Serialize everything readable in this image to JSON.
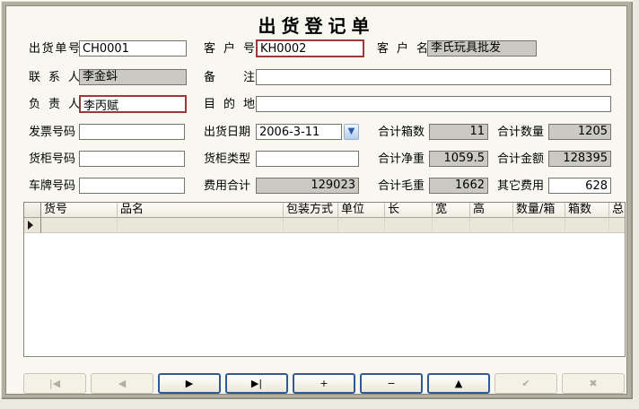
{
  "window": {
    "title": "出货登记单"
  },
  "fields": {
    "order_no": {
      "label": "出货单号",
      "value": "CH0001"
    },
    "customer_no": {
      "label": "客 户 号",
      "value": "KH0002"
    },
    "customer_name": {
      "label": "客 户 名",
      "value": "李氏玩具批发"
    },
    "contact": {
      "label": "联 系 人",
      "value": "李金蚪"
    },
    "remark": {
      "label": "备 注",
      "value": ""
    },
    "manager": {
      "label": "负 责 人",
      "value": "李丙赋"
    },
    "destination": {
      "label": "目 的 地",
      "value": ""
    },
    "invoice_no": {
      "label": "发票号码",
      "value": ""
    },
    "ship_date": {
      "label": "出货日期",
      "value": "2006-3-11"
    },
    "total_boxes": {
      "label": "合计箱数",
      "value": "11"
    },
    "total_qty": {
      "label": "合计数量",
      "value": "1205"
    },
    "container_no": {
      "label": "货柜号码",
      "value": ""
    },
    "container_type": {
      "label": "货柜类型",
      "value": ""
    },
    "total_net": {
      "label": "合计净重",
      "value": "1059.5"
    },
    "total_amount": {
      "label": "合计金额",
      "value": "128395"
    },
    "plate_no": {
      "label": "车牌号码",
      "value": ""
    },
    "expense_total": {
      "label": "费用合计",
      "value": "129023"
    },
    "total_gross": {
      "label": "合计毛重",
      "value": "1662"
    },
    "other_expense": {
      "label": "其它费用",
      "value": "628"
    }
  },
  "combo": {
    "dropdown_glyph": "▼"
  },
  "grid": {
    "columns": [
      "货号",
      "品名",
      "包装方式",
      "单位",
      "长",
      "宽",
      "高",
      "数量/箱",
      "箱数",
      "总"
    ]
  },
  "navigator": {
    "glyphs": {
      "first": "|◀",
      "prior": "◀",
      "next": "▶",
      "last": "▶|",
      "insert": "+",
      "delete": "−",
      "edit": "▲",
      "post": "✔",
      "cancel": "✖"
    }
  }
}
